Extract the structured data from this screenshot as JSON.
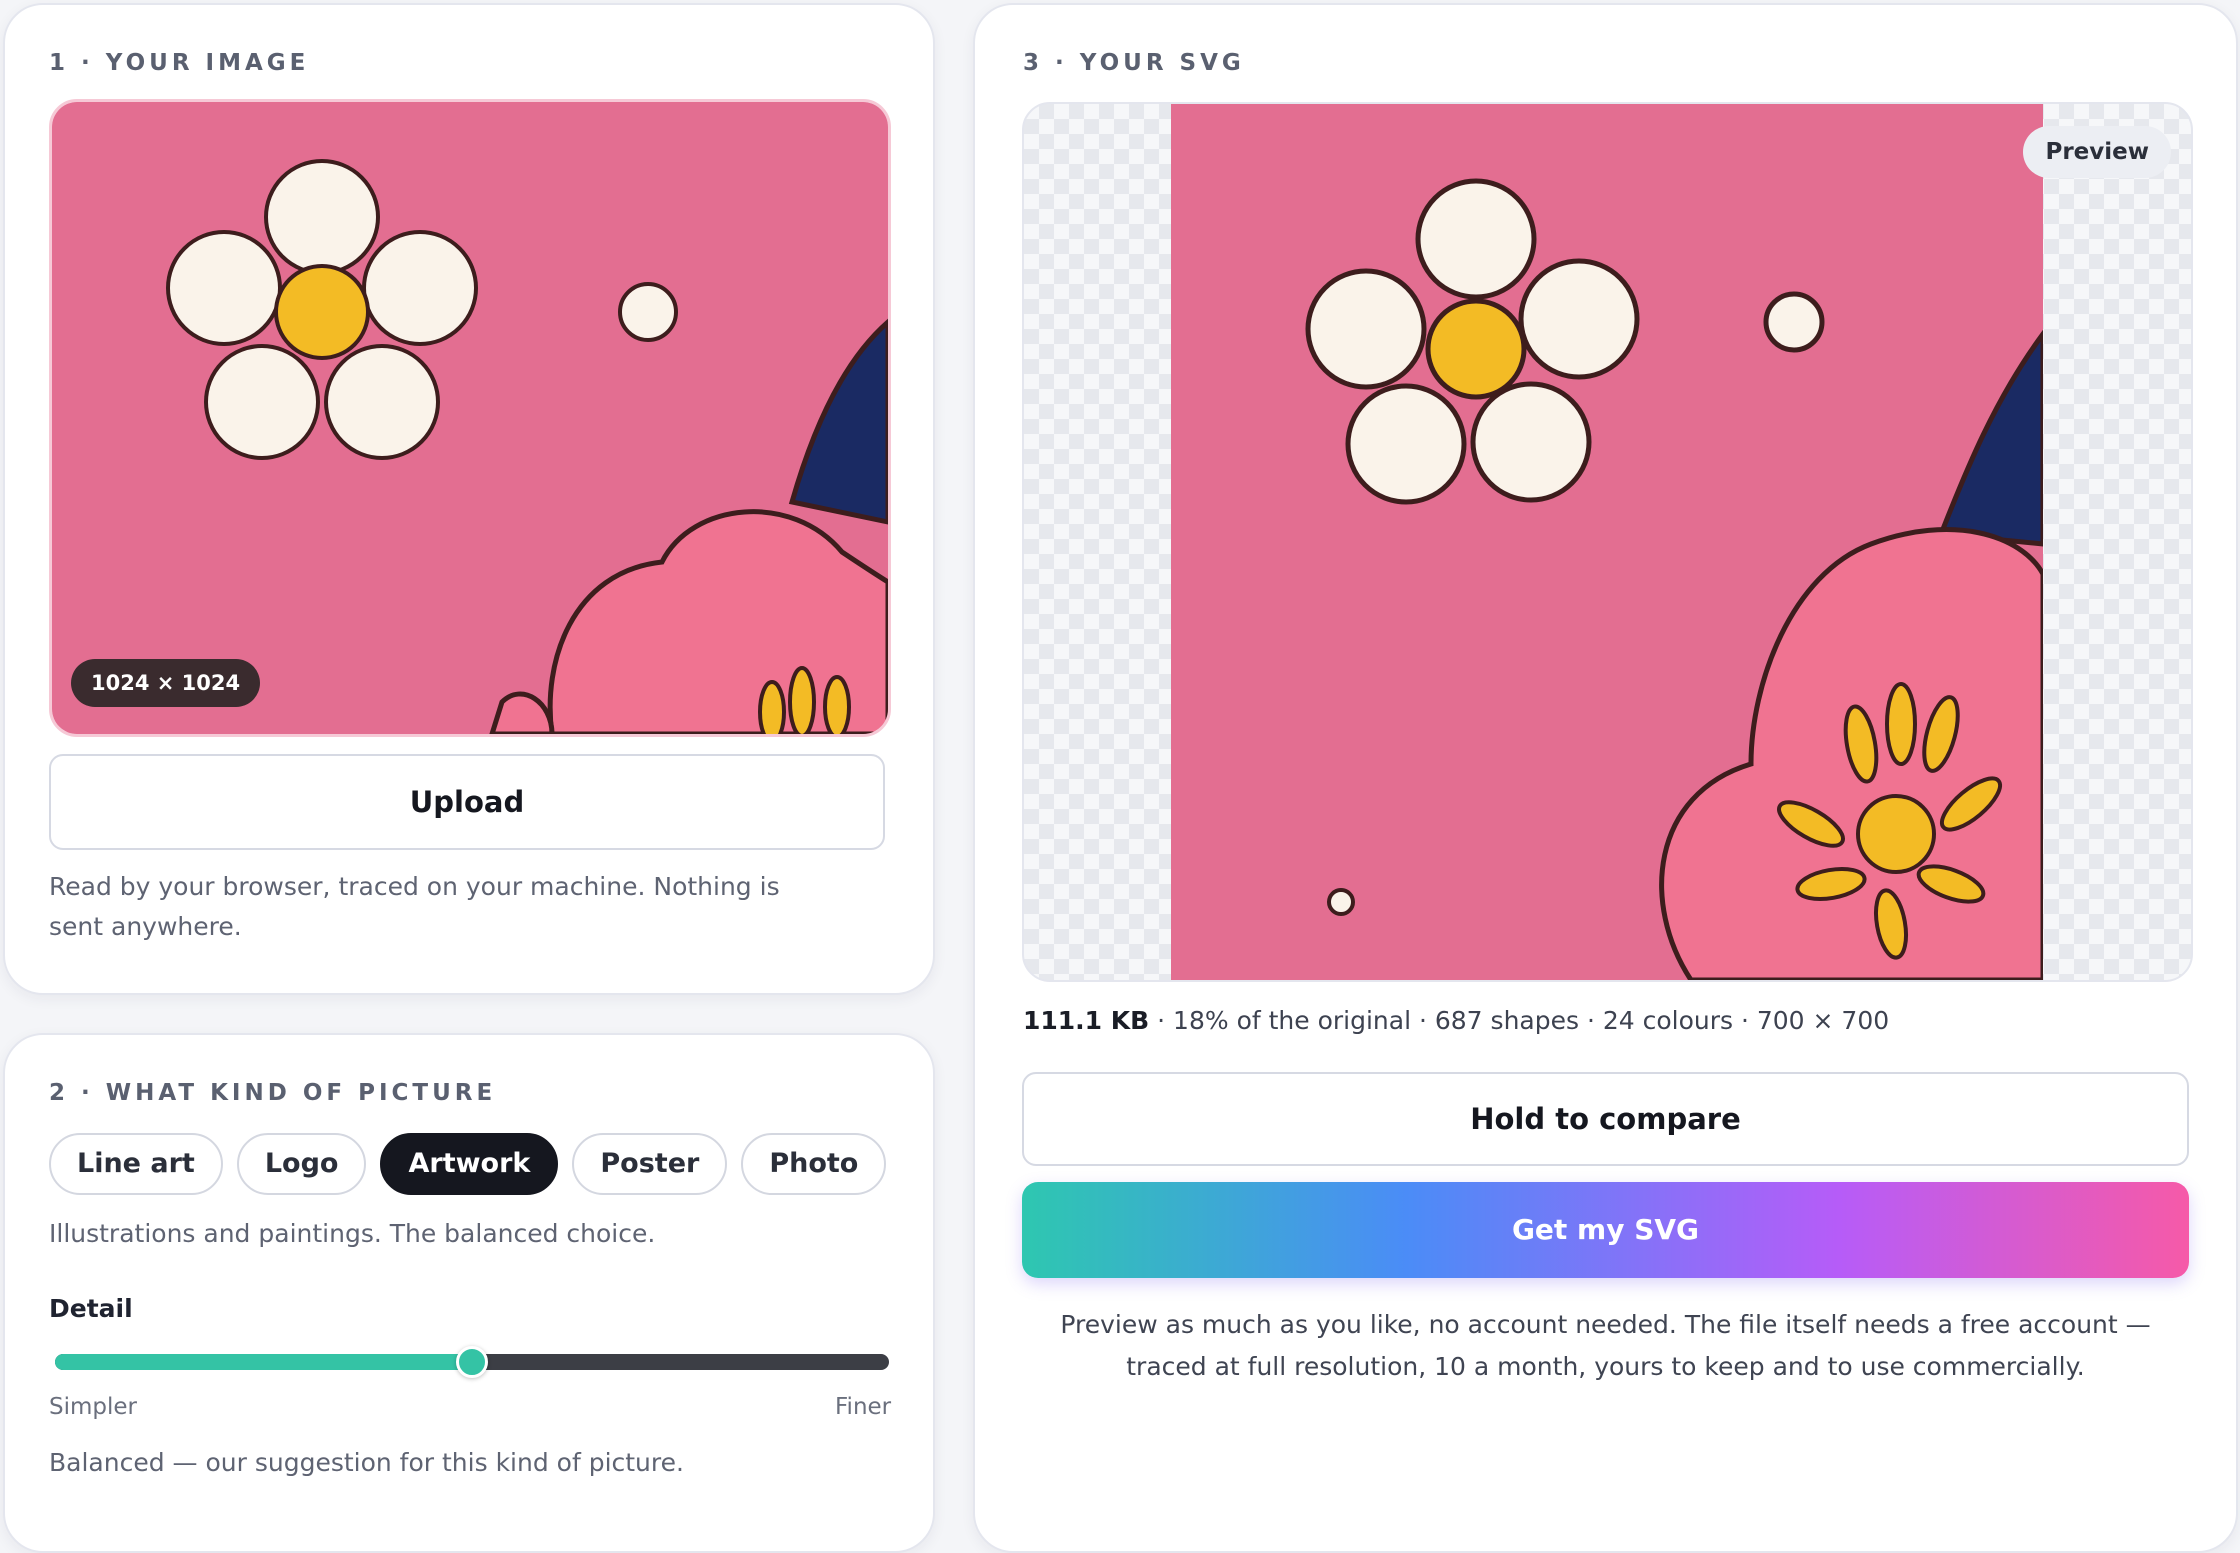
{
  "image_section": {
    "title": "1 · YOUR IMAGE",
    "dimensions_badge": "1024 × 1024",
    "upload_label": "Upload",
    "privacy_note": "Read by your browser, traced on your machine. Nothing is sent anywhere."
  },
  "kind_section": {
    "title": "2 · WHAT KIND OF PICTURE",
    "options": [
      "Line art",
      "Logo",
      "Artwork",
      "Poster",
      "Photo"
    ],
    "selected": "Artwork",
    "description": "Illustrations and paintings. The balanced choice.",
    "detail_label": "Detail",
    "detail_level": 0.5,
    "min_label": "Simpler",
    "max_label": "Finer",
    "suggestion": "Balanced — our suggestion for this kind of picture."
  },
  "svg_section": {
    "title": "3 · YOUR SVG",
    "preview_badge": "Preview",
    "file_size": "111.1 KB",
    "stats_rest": " · 18% of the original · 687 shapes · 24 colours · 700 × 700",
    "compare_label": "Hold to compare",
    "get_label": "Get my SVG",
    "footnote": "Preview as much as you like, no account needed. The file itself needs a free account — traced at full resolution, 10 a month, yours to keep and to use commercially."
  },
  "colors": {
    "background_pink": "#e36e91",
    "petal_cream": "#faf3ea",
    "center_yellow": "#f3bb25",
    "flower_pink": "#f07391",
    "navy": "#1a2a63",
    "outline": "#3d1d1d",
    "accent_teal": "#34c3a5"
  }
}
